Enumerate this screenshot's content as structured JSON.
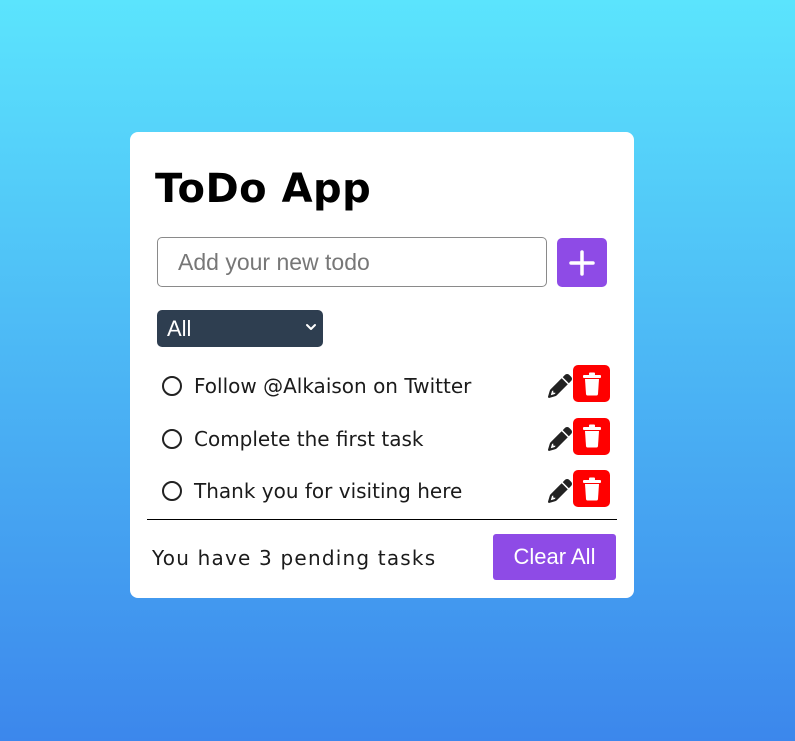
{
  "app": {
    "title": "ToDo App"
  },
  "input": {
    "value": "",
    "placeholder": "Add your new todo",
    "add_icon": "plus-icon"
  },
  "filter": {
    "selected": "All",
    "icon": "chevron-down-icon"
  },
  "todos": [
    {
      "text": "Follow @Alkaison on Twitter",
      "completed": false
    },
    {
      "text": "Complete the first task",
      "completed": false
    },
    {
      "text": "Thank you for visiting here",
      "completed": false
    }
  ],
  "icons": {
    "edit": "pencil-icon",
    "delete": "trash-icon",
    "status": "circle-icon"
  },
  "footer": {
    "pending_text": "You have 3 pending tasks",
    "pending_count": 3,
    "clear_label": "Clear All"
  },
  "colors": {
    "accent": "#8e4be6",
    "delete": "#ff0000",
    "filter_bg": "#2e3e50",
    "bg_top": "#5be4fd",
    "bg_bottom": "#3c87ec"
  }
}
